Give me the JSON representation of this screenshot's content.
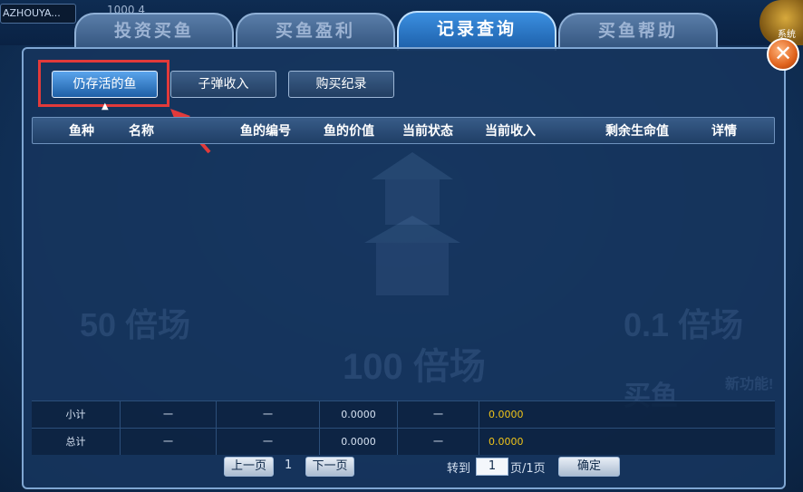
{
  "topbar": {
    "user": "AZHOUYA...",
    "gold": "1000 4"
  },
  "settings_label": "系统",
  "tabs": [
    {
      "label": "投资买鱼"
    },
    {
      "label": "买鱼盈利"
    },
    {
      "label": "记录查询",
      "active": true
    },
    {
      "label": "买鱼帮助"
    }
  ],
  "subtabs": {
    "alive": "仍存活的鱼",
    "bullet": "子弹收入",
    "purchase": "购买纪录"
  },
  "columns": [
    "鱼种",
    "名称",
    "鱼的编号",
    "鱼的价值",
    "当前状态",
    "当前收入",
    "剩余生命值",
    "详情"
  ],
  "background_art": {
    "left": "50 倍场",
    "center": "100 倍场",
    "right": "0.1 倍场",
    "buy": "买鱼",
    "new": "新功能!"
  },
  "summary": [
    {
      "label": "小计",
      "c1": "一",
      "c2": "一",
      "value": "0.0000",
      "c4": "一",
      "income": "0.0000"
    },
    {
      "label": "总计",
      "c1": "一",
      "c2": "一",
      "value": "0.0000",
      "c4": "一",
      "income": "0.0000"
    }
  ],
  "pagination": {
    "prev": "上一页",
    "current": "1",
    "next": "下一页",
    "goto": "转到",
    "goto_value": "1",
    "total": "页/1页",
    "confirm": "确定"
  },
  "colors": {
    "annotation": "#e23a3a",
    "income": "#f0c419"
  }
}
